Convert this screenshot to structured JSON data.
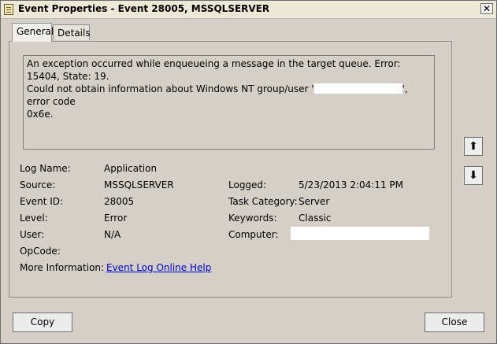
{
  "window": {
    "title": "Event Properties - Event 28005, MSSQLSERVER",
    "close_symbol": "✕"
  },
  "tabs": [
    {
      "label": "General",
      "selected": true
    },
    {
      "label": "Details",
      "selected": false
    }
  ],
  "description": {
    "line1": "An exception occurred while enqueueing a message in the target queue. Error: 15404, State: 19.",
    "line2_before": "Could not obtain information about Windows NT group/user '",
    "line2_after": "', error code",
    "line3": "0x6e."
  },
  "fields": {
    "log_name": {
      "label": "Log Name:",
      "value": "Application"
    },
    "source": {
      "label": "Source:",
      "value": "MSSQLSERVER"
    },
    "event_id": {
      "label": "Event ID:",
      "value": "28005"
    },
    "level": {
      "label": "Level:",
      "value": "Error"
    },
    "user": {
      "label": "User:",
      "value": "N/A"
    },
    "opcode": {
      "label": "OpCode:",
      "value": ""
    },
    "more_info": {
      "label": "More Information:",
      "link": "Event Log Online Help"
    },
    "logged": {
      "label": "Logged:",
      "value": "5/23/2013 2:04:11 PM"
    },
    "task_category": {
      "label": "Task Category:",
      "value": "Server"
    },
    "keywords": {
      "label": "Keywords:",
      "value": "Classic"
    },
    "computer": {
      "label": "Computer:",
      "value": ""
    }
  },
  "nav": {
    "up_symbol": "⬆",
    "down_symbol": "⬇"
  },
  "buttons": {
    "copy": "Copy",
    "close": "Close"
  }
}
